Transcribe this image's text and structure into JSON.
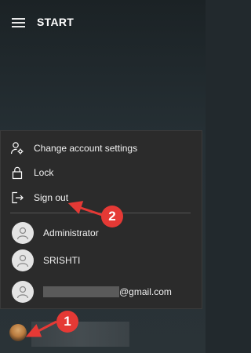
{
  "header": {
    "title": "START"
  },
  "account_menu": {
    "items": [
      {
        "label": "Change account settings",
        "icon": "person-settings-icon"
      },
      {
        "label": "Lock",
        "icon": "lock-icon"
      },
      {
        "label": "Sign out",
        "icon": "sign-out-icon"
      }
    ],
    "users": [
      {
        "label": "Administrator"
      },
      {
        "label": "SRISHTI"
      },
      {
        "label": "@gmail.com",
        "redacted_prefix": true
      }
    ]
  },
  "annotations": {
    "badge1": "1",
    "badge2": "2",
    "color": "#e53935"
  }
}
